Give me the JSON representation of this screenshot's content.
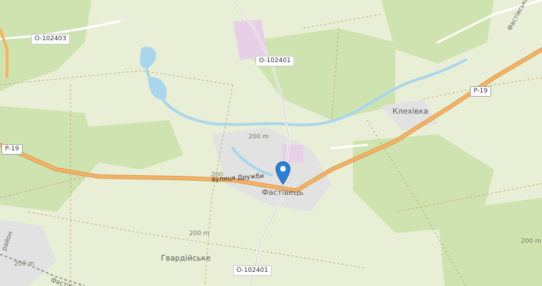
{
  "map": {
    "colors": {
      "background": "#e9efd6",
      "forest": "#cfe3b0",
      "water": "#a9d6ec",
      "residential": "#e2e2e2",
      "industrial": "#e8cfe8",
      "main_road": "#f3b266",
      "minor_road": "#ffffff",
      "boundary": "#c9a76d",
      "marker": "#2a7fd6"
    },
    "labels": {
      "city": "Фастівець",
      "village1": "Клехівка",
      "village2": "Гвардійське",
      "street": "вулиця Дружби",
      "road_right": "Фастівський",
      "road_left_bottom": "Фастівський",
      "road_left_lower": "район"
    },
    "shields": {
      "o102403": "O-102403",
      "o102401_top": "O-102401",
      "o102401_bottom": "O-102401",
      "p19_left": "P-19",
      "p19_right": "P-19"
    },
    "contours": {
      "c200a": "200 m",
      "c200b": "200",
      "c200c": "200 m",
      "c200d": "200 m",
      "c200e": "200 m"
    }
  }
}
